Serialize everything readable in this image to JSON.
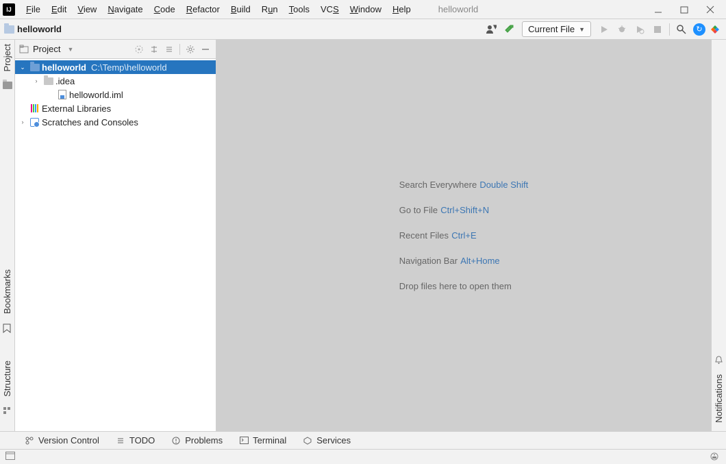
{
  "window": {
    "project_name": "helloworld"
  },
  "menu": [
    "File",
    "Edit",
    "View",
    "Navigate",
    "Code",
    "Refactor",
    "Build",
    "Run",
    "Tools",
    "VCS",
    "Window",
    "Help"
  ],
  "breadcrumb": {
    "root": "helloworld"
  },
  "toolbar": {
    "run_config": "Current File"
  },
  "project_panel": {
    "title": "Project",
    "tree": {
      "root": {
        "name": "helloworld",
        "path": "C:\\Temp\\helloworld"
      },
      "idea_folder": ".idea",
      "iml_file": "helloworld.iml",
      "external_libs": "External Libraries",
      "scratches": "Scratches and Consoles"
    }
  },
  "editor_tips": [
    {
      "label": "Search Everywhere",
      "shortcut": "Double Shift"
    },
    {
      "label": "Go to File",
      "shortcut": "Ctrl+Shift+N"
    },
    {
      "label": "Recent Files",
      "shortcut": "Ctrl+E"
    },
    {
      "label": "Navigation Bar",
      "shortcut": "Alt+Home"
    },
    {
      "label": "Drop files here to open them",
      "shortcut": ""
    }
  ],
  "left_tabs": {
    "project": "Project",
    "bookmarks": "Bookmarks",
    "structure": "Structure"
  },
  "right_tabs": {
    "notifications": "Notifications"
  },
  "bottom_tools": {
    "vcs": "Version Control",
    "todo": "TODO",
    "problems": "Problems",
    "terminal": "Terminal",
    "services": "Services"
  }
}
